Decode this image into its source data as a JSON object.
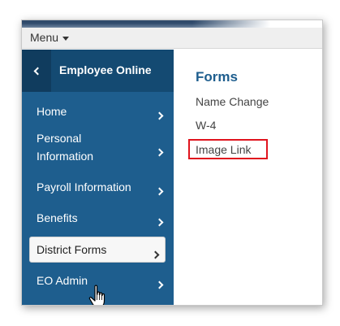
{
  "menubar": {
    "menu_label": "Menu"
  },
  "sidebar": {
    "title": "Employee Online",
    "items": [
      {
        "label": "Home"
      },
      {
        "label": "Personal Information"
      },
      {
        "label": "Payroll Information"
      },
      {
        "label": "Benefits"
      },
      {
        "label": "District Forms",
        "active": true
      },
      {
        "label": "EO Admin"
      }
    ]
  },
  "main": {
    "title": "Forms",
    "links": [
      "Name Change",
      "W-4",
      "Image Link"
    ],
    "highlighted_link": "Image Link",
    "highlight_color": "#e0141e"
  },
  "colors": {
    "sidebar": "#1e5e8e",
    "sidebar_header": "#144a72",
    "accent": "#1e5e8e"
  }
}
